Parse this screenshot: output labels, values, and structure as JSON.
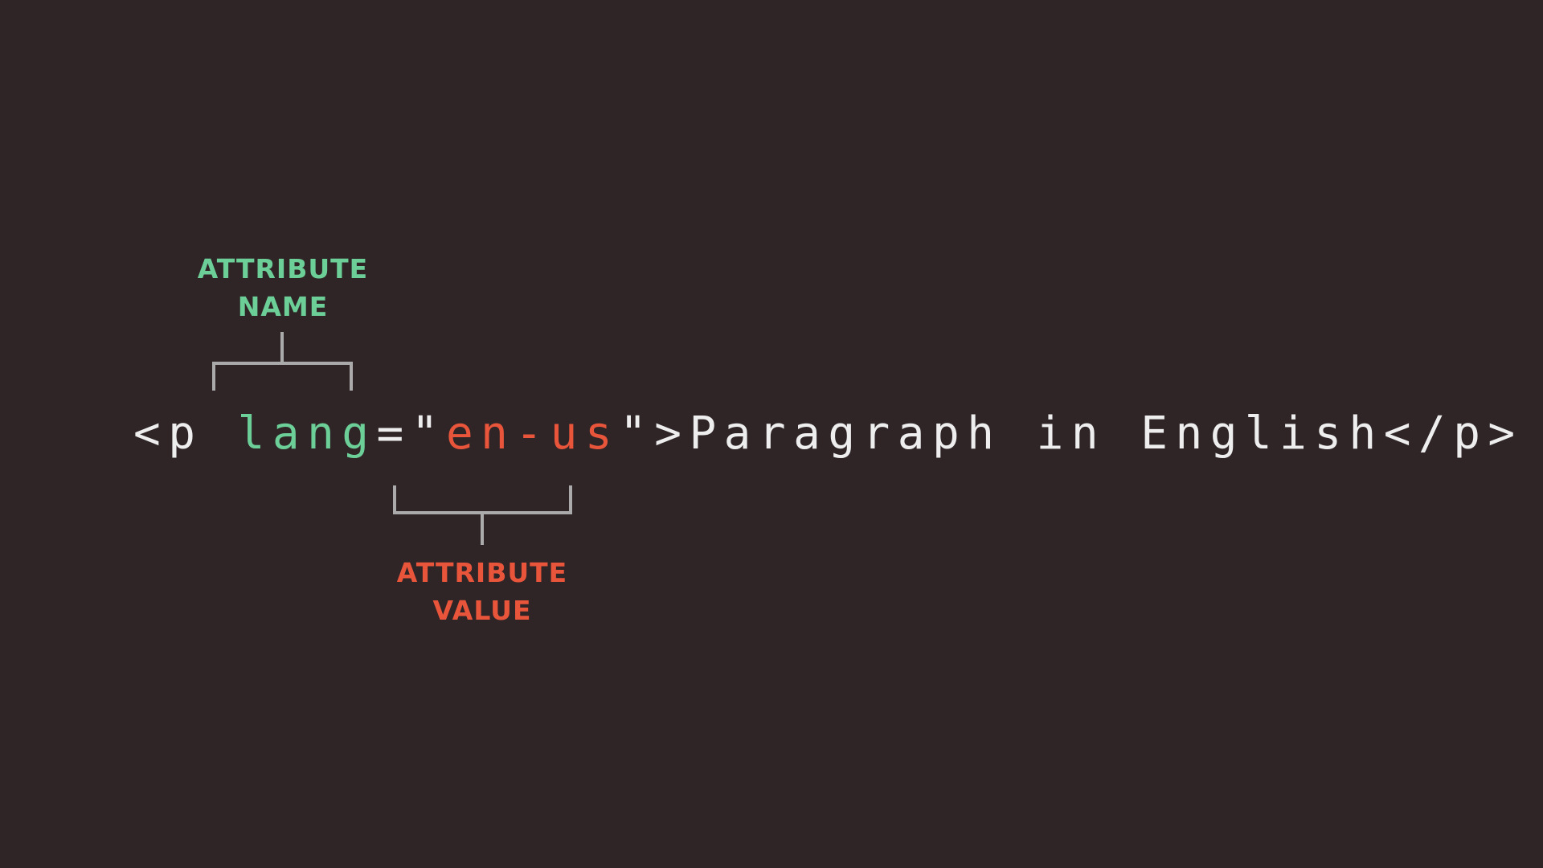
{
  "attribute_name_label": {
    "line1": "ATTRIBUTE",
    "line2": "NAME"
  },
  "attribute_value_label": {
    "line1": "ATTRIBUTE",
    "line2": "VALUE"
  },
  "code": {
    "open_tag_start": "<p ",
    "attr_name": "lang",
    "equals_quote": "=\"",
    "attr_value": "en-us",
    "quote_close": "\">",
    "content": "Paragraph in English",
    "close_tag": "</p>"
  },
  "colors": {
    "background": "#2f2527",
    "attribute_name": "#6dcf98",
    "attribute_value": "#e9553b",
    "code_text": "#eeeeee",
    "bracket_lines": "#aaaaaa"
  }
}
